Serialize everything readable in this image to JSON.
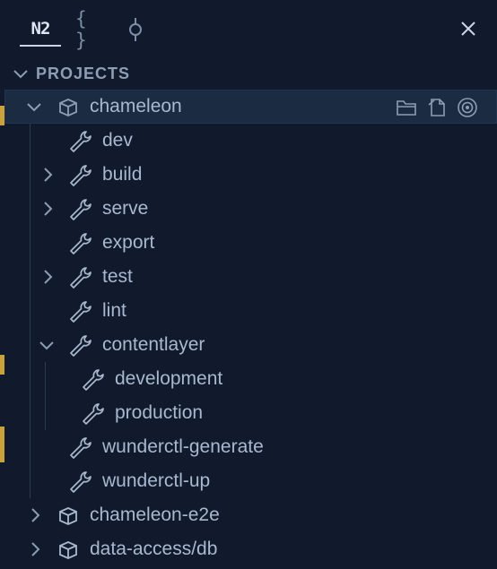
{
  "tabs": [
    {
      "name": "Nx",
      "label": "N2",
      "active": true
    },
    {
      "name": "json",
      "label": "{ }"
    },
    {
      "name": "commit",
      "label": ""
    }
  ],
  "section": {
    "title": "PROJECTS"
  },
  "projects": [
    {
      "label": "chameleon",
      "expanded": true,
      "selected": true
    },
    {
      "label": "chameleon-e2e",
      "expanded": false
    },
    {
      "label": "data-access/db",
      "expanded": false
    }
  ],
  "targets": [
    {
      "label": "dev",
      "expandable": false
    },
    {
      "label": "build",
      "expandable": true
    },
    {
      "label": "serve",
      "expandable": true
    },
    {
      "label": "export",
      "expandable": false
    },
    {
      "label": "test",
      "expandable": true
    },
    {
      "label": "lint",
      "expandable": false
    },
    {
      "label": "contentlayer",
      "expandable": true,
      "expanded": true
    },
    {
      "label": "development",
      "child": true
    },
    {
      "label": "production",
      "child": true
    },
    {
      "label": "wunderctl-generate",
      "expandable": false
    },
    {
      "label": "wunderctl-up",
      "expandable": false
    }
  ],
  "colors": {
    "background": "#101a2c",
    "text": "#a8b8cf",
    "selected": "#1b2b42",
    "gutter": "#c9a23c"
  }
}
